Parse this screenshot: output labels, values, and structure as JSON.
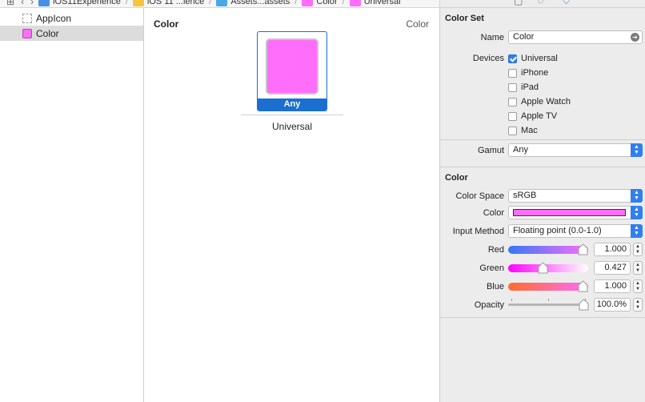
{
  "jumpbar": {
    "crumbs": [
      {
        "label": "iOS11Experience",
        "color": "#4a90e2"
      },
      {
        "label": "iOS 11 ...ience",
        "color": "#f5c542"
      },
      {
        "label": "Assets...assets",
        "color": "#4aa8e2"
      },
      {
        "label": "Color",
        "color": "#ff6dfb"
      },
      {
        "label": "Universal",
        "color": "#ff6dfb"
      }
    ]
  },
  "outline": {
    "items": [
      {
        "label": "AppIcon",
        "icon": "appicon-placeholder-icon"
      },
      {
        "label": "Color",
        "icon": "color-swatch-icon"
      }
    ]
  },
  "editor": {
    "title": "Color",
    "type_label": "Color",
    "well_label": "Any",
    "group_label": "Universal",
    "swatch_color": "#ff6dfb"
  },
  "inspector": {
    "color_set": {
      "section_title": "Color Set",
      "name_label": "Name",
      "name_value": "Color",
      "devices_label": "Devices",
      "devices": [
        {
          "label": "Universal",
          "checked": true
        },
        {
          "label": "iPhone",
          "checked": false
        },
        {
          "label": "iPad",
          "checked": false
        },
        {
          "label": "Apple Watch",
          "checked": false
        },
        {
          "label": "Apple TV",
          "checked": false
        },
        {
          "label": "Mac",
          "checked": false
        }
      ],
      "gamut_label": "Gamut",
      "gamut_value": "Any"
    },
    "color": {
      "section_title": "Color",
      "color_space_label": "Color Space",
      "color_space_value": "sRGB",
      "color_label": "Color",
      "input_method_label": "Input Method",
      "input_method_value": "Floating point (0.0-1.0)",
      "red_label": "Red",
      "red_value": "1.000",
      "green_label": "Green",
      "green_value": "0.427",
      "blue_label": "Blue",
      "blue_value": "1.000",
      "opacity_label": "Opacity",
      "opacity_value": "100.0%"
    }
  }
}
